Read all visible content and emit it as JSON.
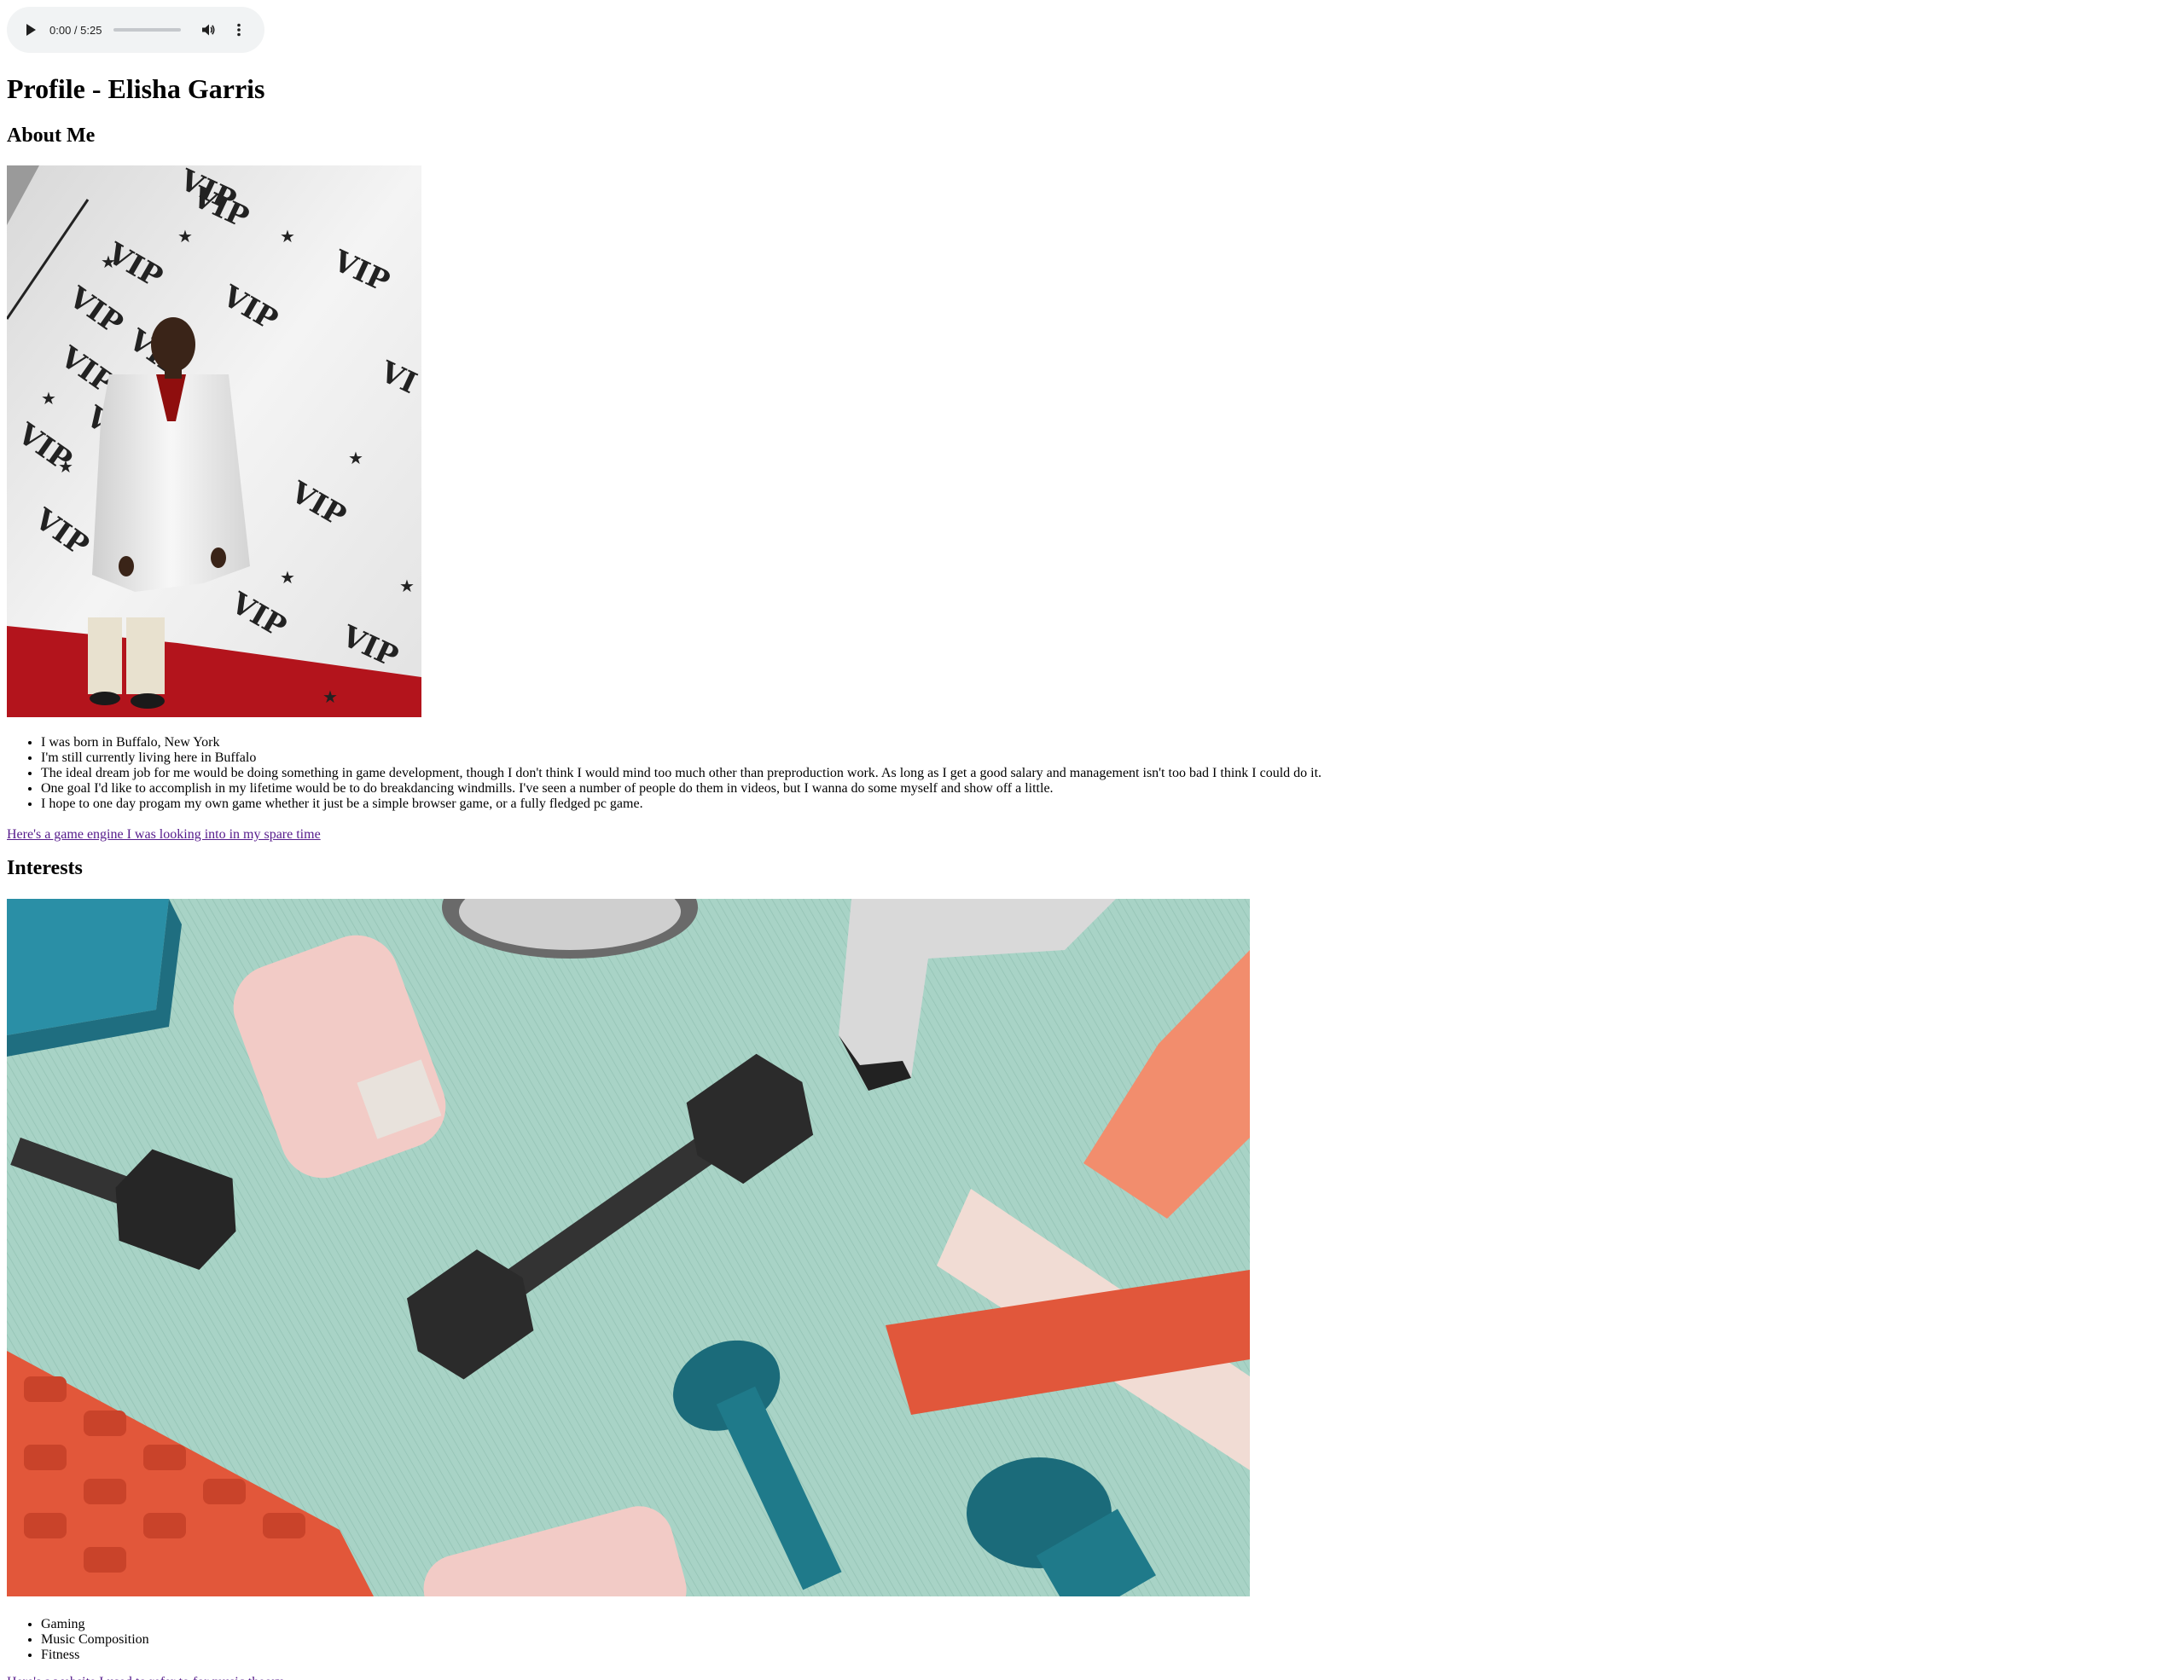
{
  "audio": {
    "time": "0:00 / 5:25",
    "progress": 0
  },
  "title": "Profile - Elisha Garris",
  "about": {
    "heading": "About Me",
    "items": [
      "I was born in Buffalo, New York",
      "I'm still currently living here in Buffalo",
      "The ideal dream job for me would be doing something in game development, though I don't think I would mind too much other than preproduction work. As long as I get a good salary and management isn't too bad I think I could do it.",
      "One goal I'd like to accomplish in my lifetime would be to do breakdancing windmills. I've seen a number of people do them in videos, but I wanna do some myself and show off a little.",
      "I hope to one day progam my own game whether it just be a simple browser game, or a fully fledged pc game."
    ],
    "link": "Here's a game engine I was looking into in my spare time"
  },
  "interests": {
    "heading": "Interests",
    "items": [
      "Gaming",
      "Music Composition",
      "Fitness"
    ],
    "link": "Here's a website I used to refer to for music theory"
  },
  "colors": {
    "link_visited": "#551a8b",
    "player_bg": "#f1f3f4",
    "mat": "#a8d3c6"
  }
}
